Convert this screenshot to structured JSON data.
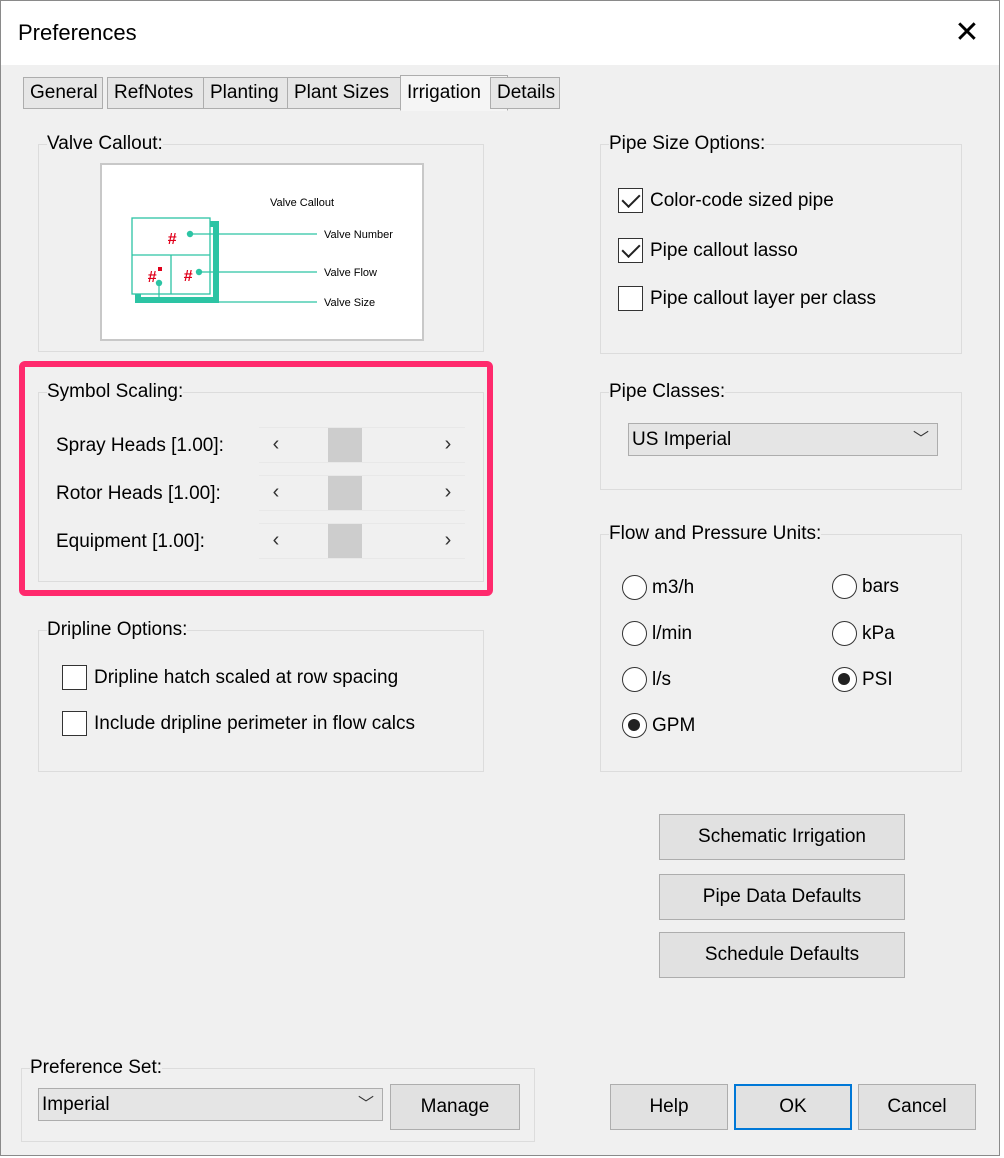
{
  "window": {
    "title": "Preferences",
    "close": "✕"
  },
  "tabs": [
    "General",
    "RefNotes",
    "Planting",
    "Plant Sizes",
    "Irrigation",
    "Details"
  ],
  "valve_callout": {
    "label": "Valve Callout:",
    "preview": {
      "title": "Valve Callout",
      "valve_number": "Valve Number",
      "valve_flow": "Valve Flow",
      "valve_size": "Valve Size",
      "hash": "#",
      "accent": "#2cc4a4",
      "hash_color": "#e0001b"
    }
  },
  "symbol_scaling": {
    "label": "Symbol Scaling:",
    "rows": [
      {
        "label": "Spray Heads [1.00]:",
        "value": 1.0
      },
      {
        "label": "Rotor Heads [1.00]:",
        "value": 1.0
      },
      {
        "label": "Equipment [1.00]:",
        "value": 1.0
      }
    ],
    "left_arrow": "‹",
    "right_arrow": "›"
  },
  "dripline": {
    "label": "Dripline Options:",
    "options": [
      {
        "label": "Dripline hatch scaled at row spacing",
        "checked": false
      },
      {
        "label": "Include dripline perimeter in flow calcs",
        "checked": false
      }
    ]
  },
  "pipe_size": {
    "label": "Pipe Size Options:",
    "options": [
      {
        "label": "Color-code sized pipe",
        "checked": true
      },
      {
        "label": "Pipe callout lasso",
        "checked": true
      },
      {
        "label": "Pipe callout layer per class",
        "checked": false
      }
    ]
  },
  "pipe_classes": {
    "label": "Pipe Classes:",
    "selected": "US Imperial"
  },
  "flow_units": {
    "label": "Flow and Pressure Units:",
    "flow": [
      {
        "label": "m3/h",
        "checked": false
      },
      {
        "label": "l/min",
        "checked": false
      },
      {
        "label": "l/s",
        "checked": false
      },
      {
        "label": "GPM",
        "checked": true
      }
    ],
    "pressure": [
      {
        "label": "bars",
        "checked": false
      },
      {
        "label": "kPa",
        "checked": false
      },
      {
        "label": "PSI",
        "checked": true
      }
    ]
  },
  "buttons": {
    "schematic": "Schematic Irrigation",
    "pipe_data": "Pipe Data Defaults",
    "schedule": "Schedule Defaults",
    "manage": "Manage",
    "help": "Help",
    "ok": "OK",
    "cancel": "Cancel"
  },
  "preference_set": {
    "label": "Preference Set:",
    "selected": "Imperial"
  },
  "colors": {
    "highlight": "#ff2a6d",
    "default_button_border": "#0078d7"
  }
}
